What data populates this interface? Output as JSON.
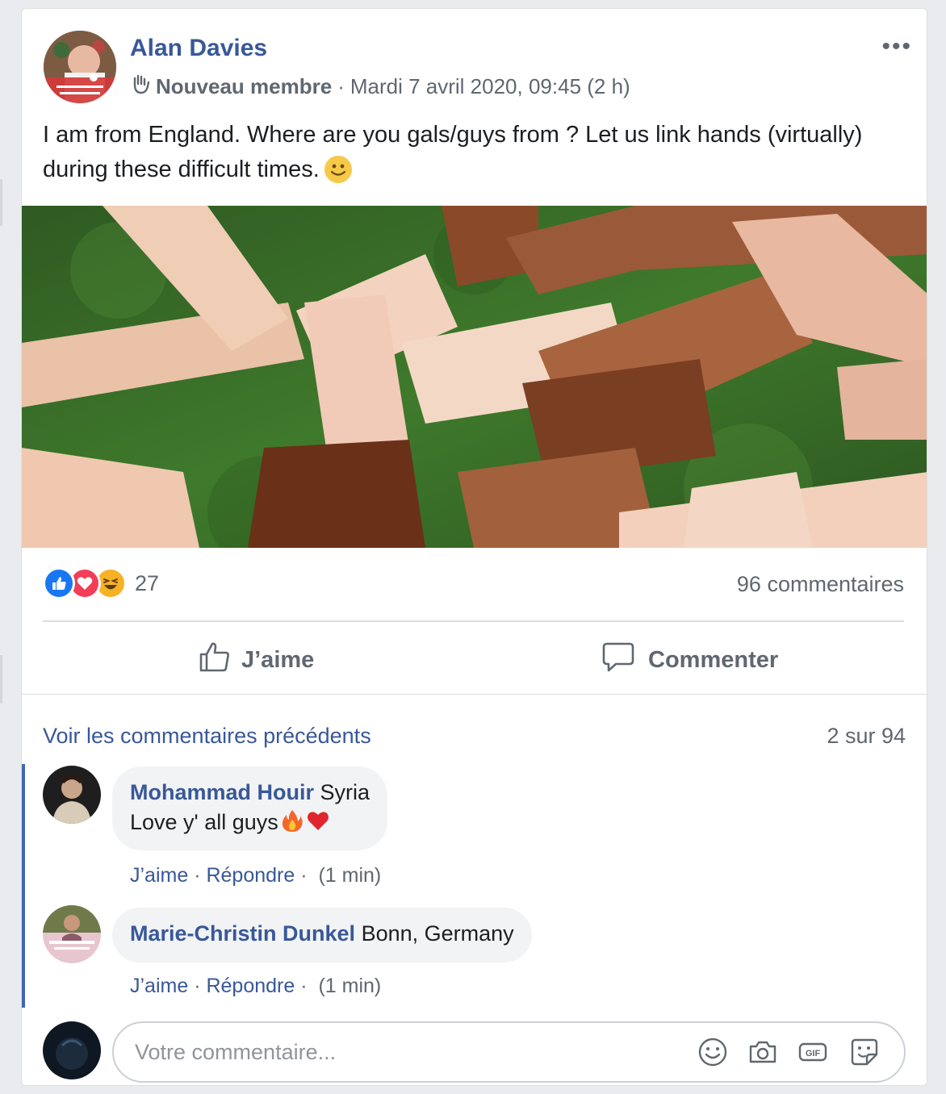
{
  "post": {
    "author": "Alan Davies",
    "badge": "Nouveau membre",
    "timestamp": "Mardi 7 avril 2020, 09:45 (2 h)",
    "text": "I am from England. Where are you gals/guys from ? Let us link hands (virtually) during these difficult times.",
    "more_label": "•••"
  },
  "stats": {
    "reaction_count": "27",
    "comment_count": "96 commentaires"
  },
  "actions": {
    "like": "J’aime",
    "comment": "Commenter"
  },
  "comments_section": {
    "previous_link": "Voir les commentaires précédents",
    "pager": "2 sur 94",
    "comments": [
      {
        "author": "Mohammad Houir",
        "text_line1": "Syria",
        "text_line2": "Love y' all guys",
        "like": "J’aime",
        "reply": "Répondre",
        "time": "(1 min)"
      },
      {
        "author": "Marie-Christin Dunkel",
        "text_line1": "Bonn, Germany",
        "like": "J’aime",
        "reply": "Répondre",
        "time": "(1 min)"
      }
    ],
    "composer_placeholder": "Votre commentaire..."
  },
  "colors": {
    "link_blue": "#385898",
    "thread_blue": "#4267b2",
    "secondary_text": "#606770",
    "like_blue": "#1877f2",
    "love_red": "#f33e58",
    "haha_yellow": "#f7b125"
  },
  "icons": [
    "more-options-icon",
    "wave-icon",
    "smiley-emoji",
    "like-reaction-icon",
    "love-reaction-icon",
    "haha-reaction-icon",
    "thumbs-up-icon",
    "speech-bubble-icon",
    "fire-emoji",
    "heart-emoji",
    "emoji-icon",
    "camera-icon",
    "gif-icon",
    "sticker-icon"
  ]
}
